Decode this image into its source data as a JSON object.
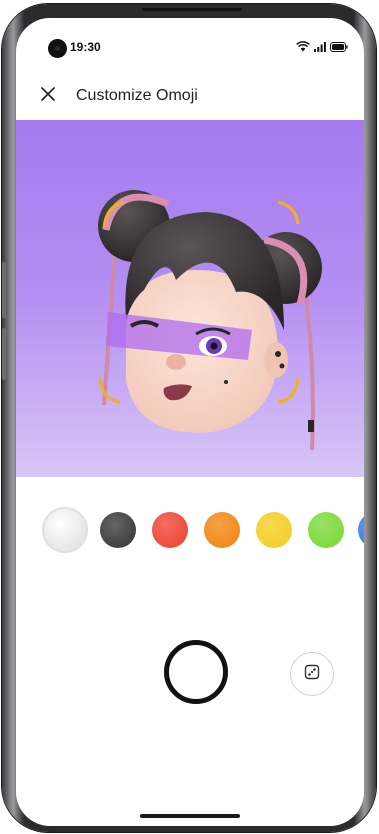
{
  "status": {
    "time": "19:30"
  },
  "header": {
    "title": "Customize Omoji",
    "close_icon": "close-icon"
  },
  "colors": {
    "preview_top": "#a57af0",
    "preview_bottom": "#d8c6f7",
    "swatches": [
      "#e6e6e6",
      "#3f3f3f",
      "#ef4a3a",
      "#f28a1a",
      "#f5cf2a",
      "#7fda3e",
      "#3f7fe8"
    ]
  },
  "swatch_names": [
    "white",
    "black",
    "red",
    "orange",
    "yellow",
    "green",
    "blue"
  ],
  "controls": {
    "shutter_icon": "capture-button",
    "random_icon": "dice-icon"
  }
}
